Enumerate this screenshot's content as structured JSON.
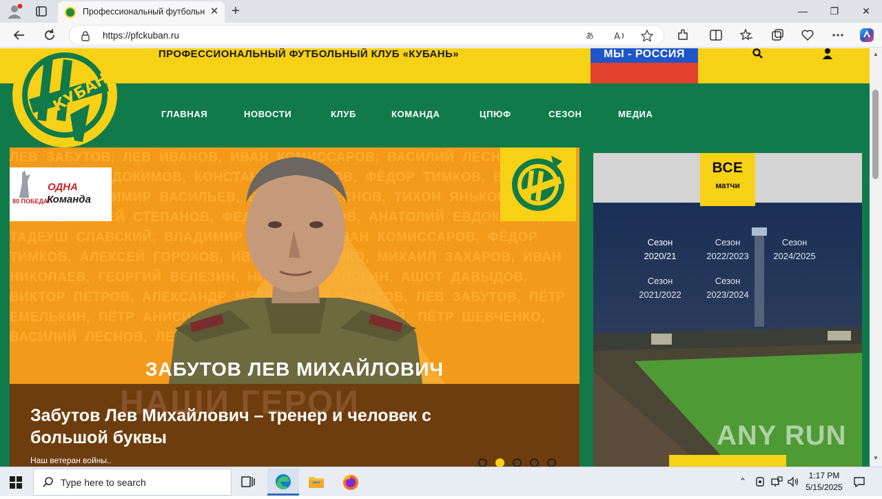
{
  "browser": {
    "tab_title": "Профессиональный футбольный клуб «Кубань»",
    "tab_close": "✕",
    "new_tab": "+",
    "url": "https://pfckuban.ru",
    "window_minimize": "—",
    "window_maximize": "❐",
    "window_close": "✕"
  },
  "site": {
    "header_title": "ПРОФЕССИОНАЛЬНЫЙ ФУТБОЛЬНЫЙ КЛУБ «КУБАНЬ»",
    "russia_banner": "МЫ - РОССИЯ",
    "nav": [
      "ГЛАВНАЯ",
      "НОВОСТИ",
      "КЛУБ",
      "КОМАНДА",
      "ЦПЮФ",
      "СЕЗОН",
      "МЕДИА"
    ]
  },
  "hero": {
    "bg_text": "ЛЕВ ЗАБУТОВ, ЛЕВ ИВАНОВ, ИВАН КОМИССАРОВ, ВАСИЛИЙ ЛЕСНОВ, АНАТОЛИЙ ЕВДОКИМОВ, КОНСТАНТИН КИСЛОВ, ФЁДОР ТИМКОВ, ВАСИЛИЙ ЖИЛИН, ВЛАДИМИР ВАСИЛЬЕВ, ВАСИЛИЙ ЛЕСНОВ, ТИХОН ЯНЬКОВ, ИВАН САНИН, СЕРГЕЙ СТЕПАНОВ, ФЕДОР ЗАВЬЯЛОВ, АНАТОЛИЙ ЕВДОКИМОВ, ТАДЕУШ СЛАВСКИЙ, ВЛАДИМИР АРСЕНОВ, ИВАН КОМИССАРОВ, ФЁДОР ТИМКОВ, АЛЕКСЕЙ ГОРОХОВ, ИВАН ПОХОРОНКО, МИХАИЛ ЗАХАРОВ, ИВАН НИКОЛАЕВ, ГЕОРГИЙ ВЕЛЕЗИН, НИКОЛАЙ ЗАЛОГИН, АШОТ ДАВЫДОВ, ВИКТОР ПЕТРОВ, АЛЕКСАНДР МЕДВЕДЕВ, АФАНАСОВ, ЛЕВ ЗАБУТОВ, ПЁТР ЕМЕЛЬКИН, ПЁТР АНИСИМОВ, НИКОЛАЙ РЕСНЯНСКИЙ, ПЁТР ШЕВЧЕНКО, ВАСИЛИЙ ЛЕСНОВ, ЛЕВ ЗАБУТОВ",
    "badge_80": "80 ПОБЕДА!",
    "badge_odna": "ОДНА",
    "badge_komanda": "Команда",
    "name_banner": "ЗАБУТОВ ЛЕВ МИХАЙЛОВИЧ",
    "ghost_text": "НАШИ ГЕРОИ",
    "headline": "Забутов Лев Михайлович – тренер и человек с большой буквы",
    "subtitle": "Наш ветеран войны..",
    "dots_count": 5,
    "active_dot": 1
  },
  "matches": {
    "all_big": "ВСЕ",
    "all_small": "матчи",
    "seasons": [
      {
        "word": "Сезон",
        "year": "2020/21",
        "current": true
      },
      {
        "word": "Сезон",
        "year": "2022/2023",
        "current": false
      },
      {
        "word": "Сезон",
        "year": "2024/2025",
        "current": false
      },
      {
        "word": "Сезон",
        "year": "2021/2022",
        "current": false
      },
      {
        "word": "Сезон",
        "year": "2023/2024",
        "current": false
      }
    ]
  },
  "watermark": "ANY RUN",
  "taskbar": {
    "search_placeholder": "Type here to search",
    "time": "1:17 PM",
    "date": "5/15/2025"
  },
  "colors": {
    "club_green": "#107a4a",
    "club_yellow": "#f7d116",
    "hero_orange": "#f39a1b",
    "matches_navy": "#1c3354"
  }
}
